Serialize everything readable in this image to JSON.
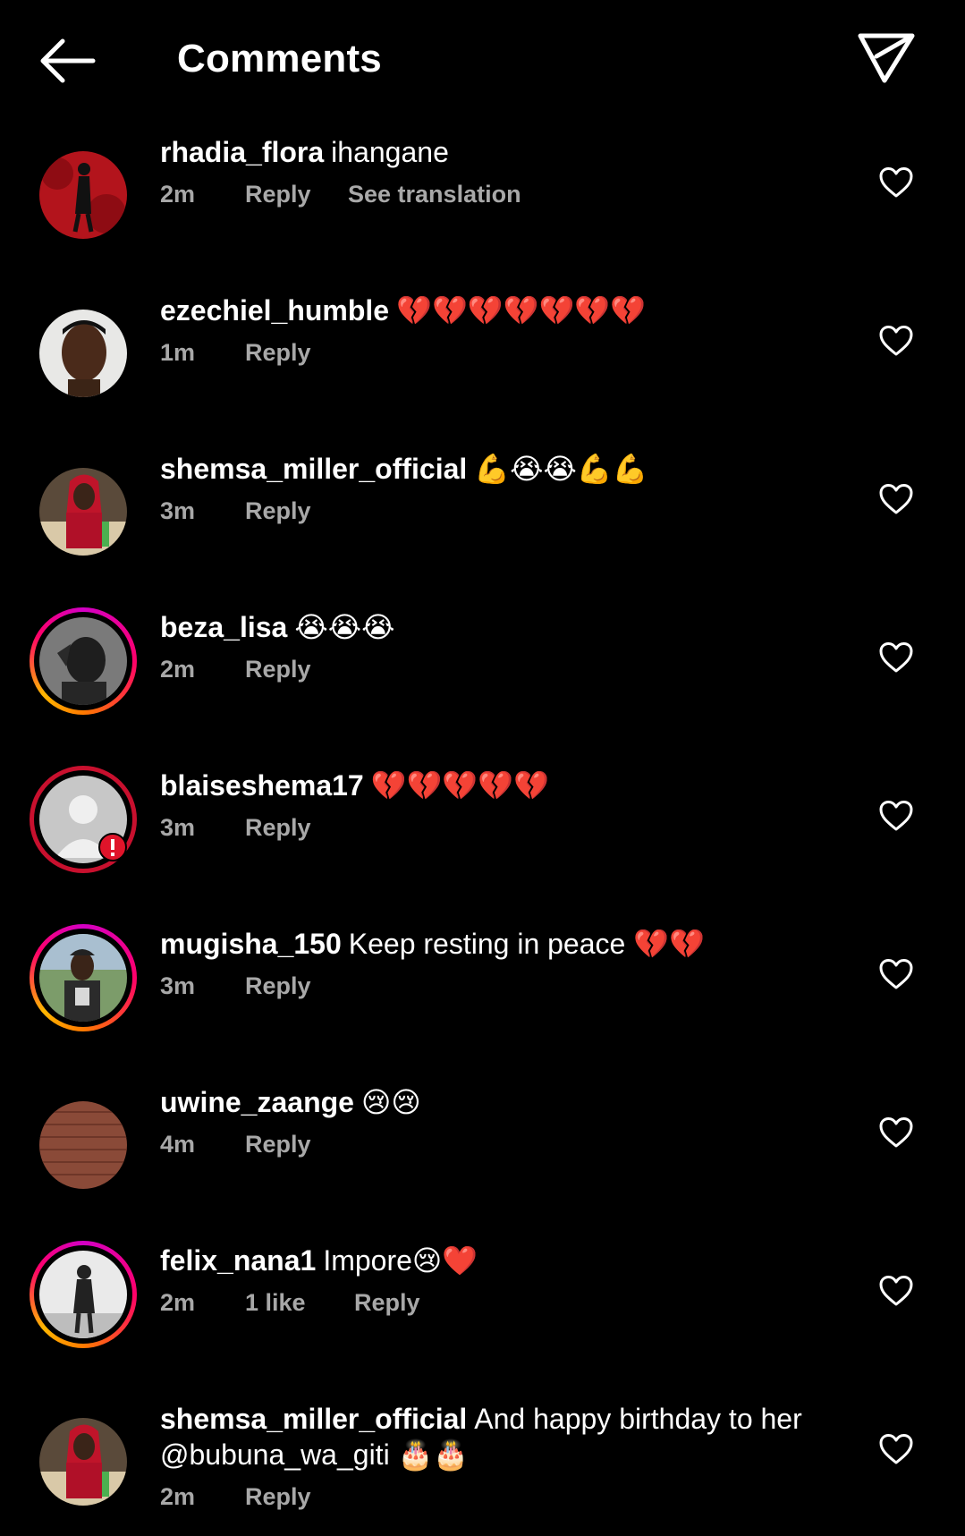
{
  "header": {
    "title": "Comments"
  },
  "comments": [
    {
      "username": "rhadia_flora",
      "text": "ihangane",
      "time": "2m",
      "reply": "Reply",
      "extra": "See translation"
    },
    {
      "username": "ezechiel_humble",
      "text": "💔💔💔💔💔💔💔",
      "time": "1m",
      "reply": "Reply"
    },
    {
      "username": "shemsa_miller_official",
      "text": "💪😭😭💪💪",
      "time": "3m",
      "reply": "Reply"
    },
    {
      "username": "beza_lisa",
      "text": "😭😭😭",
      "time": "2m",
      "reply": "Reply"
    },
    {
      "username": "blaiseshema17",
      "text": "💔💔💔💔💔",
      "time": "3m",
      "reply": "Reply"
    },
    {
      "username": "mugisha_150",
      "text": "Keep resting in peace 💔💔",
      "time": "3m",
      "reply": "Reply"
    },
    {
      "username": "uwine_zaange",
      "text": "😢😢",
      "time": "4m",
      "reply": "Reply"
    },
    {
      "username": "felix_nana1",
      "text": "Impore😢❤️",
      "time": "2m",
      "likes": "1 like",
      "reply": "Reply"
    },
    {
      "username": "shemsa_miller_official",
      "text": "And happy birthday to her @bubuna_wa_giti 🎂🎂",
      "time": "2m",
      "reply": "Reply"
    }
  ],
  "colors": {
    "background": "#000000",
    "text": "#ffffff",
    "meta": "#a8a8a8",
    "story_ring_start": "#d300c5",
    "story_ring_end": "#ffb700",
    "alert_red": "#c8102e"
  },
  "icons": {
    "back": "back-arrow-icon",
    "share": "paper-plane-icon",
    "like": "heart-outline-icon"
  }
}
